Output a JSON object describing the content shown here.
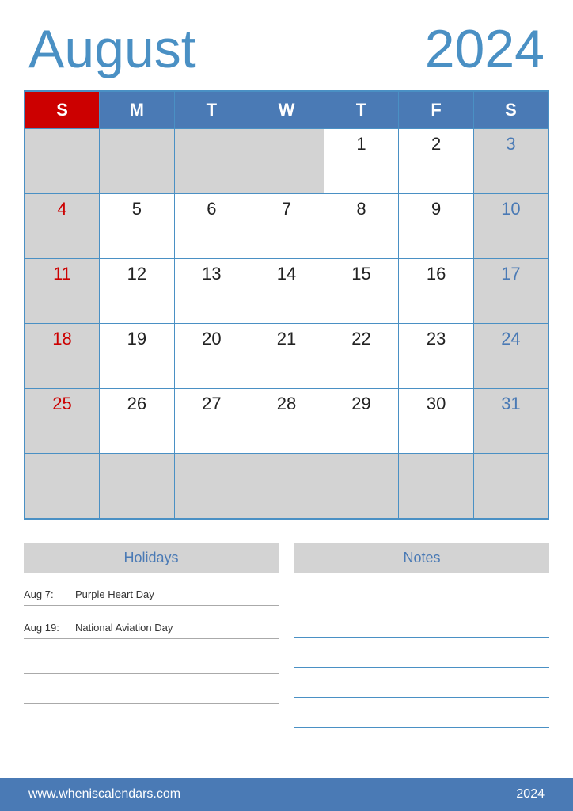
{
  "header": {
    "month": "August",
    "year": "2024"
  },
  "calendar": {
    "days_of_week": [
      "S",
      "M",
      "T",
      "W",
      "T",
      "F",
      "S"
    ],
    "weeks": [
      [
        "",
        "",
        "",
        "",
        "1",
        "2",
        "3"
      ],
      [
        "4",
        "5",
        "6",
        "7",
        "8",
        "9",
        "10"
      ],
      [
        "11",
        "12",
        "13",
        "14",
        "15",
        "16",
        "17"
      ],
      [
        "18",
        "19",
        "20",
        "21",
        "22",
        "23",
        "24"
      ],
      [
        "25",
        "26",
        "27",
        "28",
        "29",
        "30",
        "31"
      ],
      [
        "",
        "",
        "",
        "",
        "",
        "",
        ""
      ]
    ]
  },
  "holidays": {
    "title": "Holidays",
    "items": [
      {
        "date": "Aug 7:",
        "name": "Purple Heart Day"
      },
      {
        "date": "Aug 19:",
        "name": "National Aviation Day"
      }
    ]
  },
  "notes": {
    "title": "Notes",
    "lines": [
      "",
      "",
      "",
      "",
      ""
    ]
  },
  "footer": {
    "url": "www.wheniscalendars.com",
    "year": "2024"
  }
}
